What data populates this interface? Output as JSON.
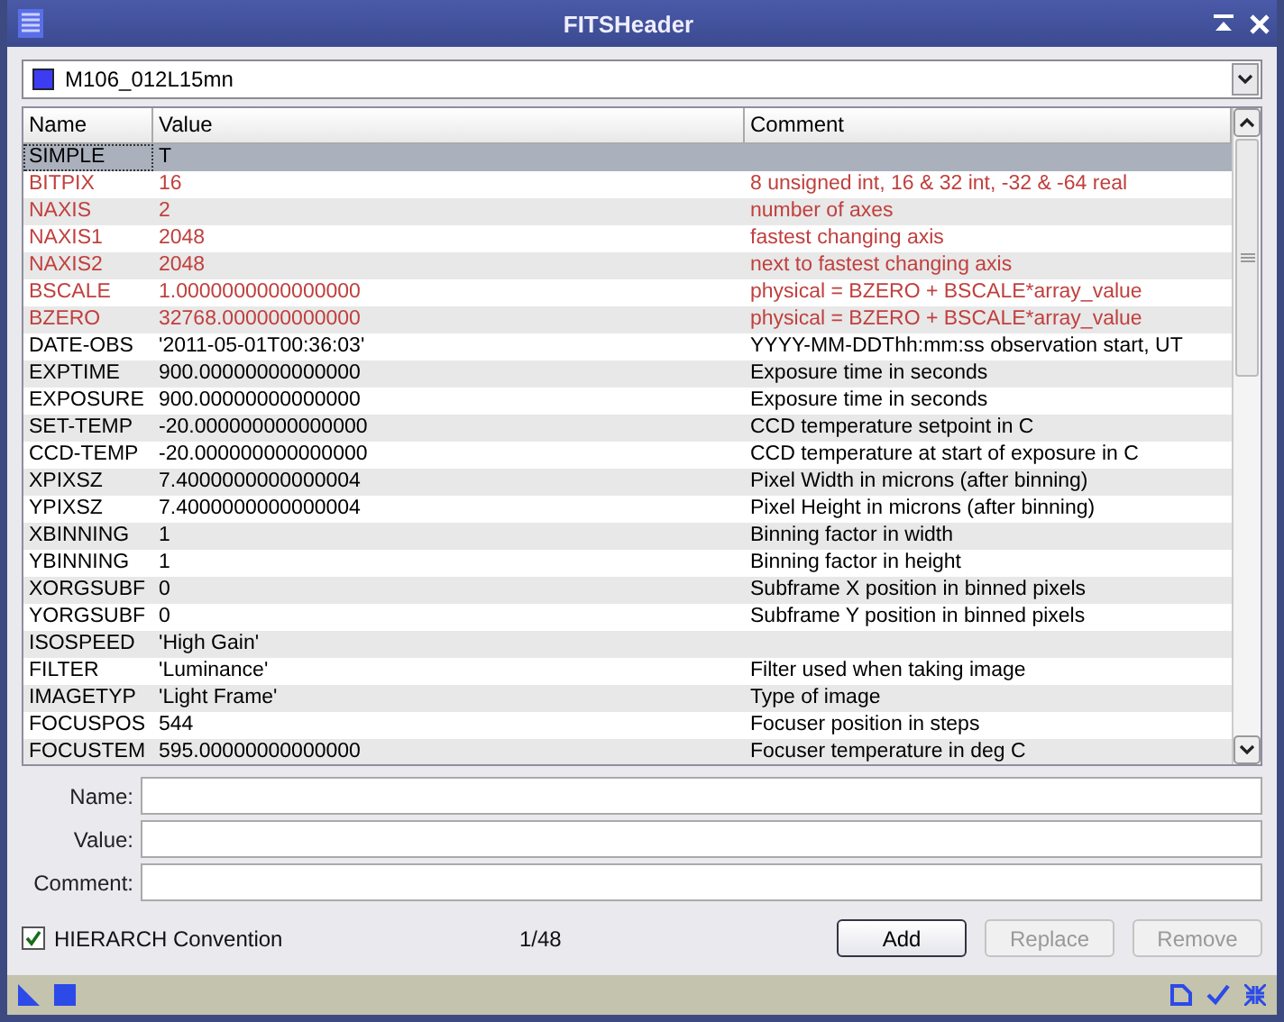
{
  "window": {
    "title": "FITSHeader"
  },
  "file_selector": {
    "value": "M106_012L15mn"
  },
  "table": {
    "columns": [
      "Name",
      "Value",
      "Comment"
    ],
    "rows": [
      {
        "name": "SIMPLE",
        "value": "T",
        "comment": "",
        "kind": "reserved",
        "selected": true
      },
      {
        "name": "BITPIX",
        "value": "16",
        "comment": "8 unsigned int, 16 & 32 int, -32 & -64 real",
        "kind": "reserved",
        "selected": false
      },
      {
        "name": "NAXIS",
        "value": "2",
        "comment": "number of axes",
        "kind": "reserved",
        "selected": false
      },
      {
        "name": "NAXIS1",
        "value": "2048",
        "comment": "fastest changing axis",
        "kind": "reserved",
        "selected": false
      },
      {
        "name": "NAXIS2",
        "value": "2048",
        "comment": "next to fastest changing axis",
        "kind": "reserved",
        "selected": false
      },
      {
        "name": "BSCALE",
        "value": "1.0000000000000000",
        "comment": "physical = BZERO + BSCALE*array_value",
        "kind": "reserved",
        "selected": false
      },
      {
        "name": "BZERO",
        "value": "32768.000000000000",
        "comment": "physical = BZERO + BSCALE*array_value",
        "kind": "reserved",
        "selected": false
      },
      {
        "name": "DATE-OBS",
        "value": "'2011-05-01T00:36:03'",
        "comment": "YYYY-MM-DDThh:mm:ss observation start, UT",
        "kind": "user",
        "selected": false
      },
      {
        "name": "EXPTIME",
        "value": "900.00000000000000",
        "comment": "Exposure time in seconds",
        "kind": "user",
        "selected": false
      },
      {
        "name": "EXPOSURE",
        "value": "900.00000000000000",
        "comment": "Exposure time in seconds",
        "kind": "user",
        "selected": false
      },
      {
        "name": "SET-TEMP",
        "value": "-20.000000000000000",
        "comment": "CCD temperature setpoint in C",
        "kind": "user",
        "selected": false
      },
      {
        "name": "CCD-TEMP",
        "value": "-20.000000000000000",
        "comment": "CCD temperature at start of exposure in C",
        "kind": "user",
        "selected": false
      },
      {
        "name": "XPIXSZ",
        "value": "7.4000000000000004",
        "comment": "Pixel Width in microns (after binning)",
        "kind": "user",
        "selected": false
      },
      {
        "name": "YPIXSZ",
        "value": "7.4000000000000004",
        "comment": "Pixel Height in microns (after binning)",
        "kind": "user",
        "selected": false
      },
      {
        "name": "XBINNING",
        "value": "1",
        "comment": "Binning factor in width",
        "kind": "user",
        "selected": false
      },
      {
        "name": "YBINNING",
        "value": "1",
        "comment": "Binning factor in height",
        "kind": "user",
        "selected": false
      },
      {
        "name": "XORGSUBF",
        "value": "0",
        "comment": "Subframe X position in binned pixels",
        "kind": "user",
        "selected": false
      },
      {
        "name": "YORGSUBF",
        "value": "0",
        "comment": "Subframe Y position in binned pixels",
        "kind": "user",
        "selected": false
      },
      {
        "name": "ISOSPEED",
        "value": "'High Gain'",
        "comment": "",
        "kind": "user",
        "selected": false
      },
      {
        "name": "FILTER",
        "value": "'Luminance'",
        "comment": "Filter used when taking image",
        "kind": "user",
        "selected": false
      },
      {
        "name": "IMAGETYP",
        "value": "'Light Frame'",
        "comment": "Type of image",
        "kind": "user",
        "selected": false
      },
      {
        "name": "FOCUSPOS",
        "value": "544",
        "comment": "Focuser position in steps",
        "kind": "user",
        "selected": false
      },
      {
        "name": "FOCUSTEM",
        "value": "595.00000000000000",
        "comment": "Focuser temperature in deg C",
        "kind": "user",
        "selected": false
      }
    ]
  },
  "fields": [
    {
      "label": "Name:"
    },
    {
      "label": "Value:"
    },
    {
      "label": "Comment:"
    }
  ],
  "hierarch": {
    "label": "HIERARCH Convention",
    "checked": true
  },
  "counter": "1/48",
  "buttons": [
    {
      "label": "Add",
      "disabled": false
    },
    {
      "label": "Replace",
      "disabled": true
    },
    {
      "label": "Remove",
      "disabled": true
    }
  ]
}
